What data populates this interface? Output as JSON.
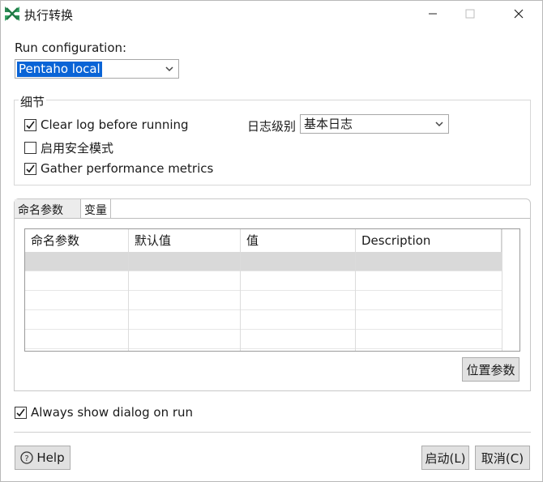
{
  "window": {
    "title": "执行转换",
    "app_icon": "pentaho-spoon-icon"
  },
  "run_configuration": {
    "label": "Run configuration:",
    "selected": "Pentaho local"
  },
  "details": {
    "group_title": "细节",
    "clear_log": {
      "label": "Clear log before running",
      "checked": true
    },
    "safe_mode": {
      "label": "启用安全模式",
      "checked": false
    },
    "gather_metrics": {
      "label": "Gather performance metrics",
      "checked": true
    },
    "log_level_label": "日志级别",
    "log_level_value": "基本日志"
  },
  "tabs": [
    {
      "label": "命名参数",
      "active": true
    },
    {
      "label": "变量",
      "active": false
    }
  ],
  "params_table": {
    "columns": [
      "命名参数",
      "默认值",
      "值",
      "Description"
    ],
    "rows": [
      [
        "",
        "",
        "",
        ""
      ],
      [
        "",
        "",
        "",
        ""
      ],
      [
        "",
        "",
        "",
        ""
      ],
      [
        "",
        "",
        "",
        ""
      ],
      [
        "",
        "",
        "",
        ""
      ]
    ]
  },
  "position_params_button": "位置参数",
  "always_show": {
    "label": "Always show dialog on run",
    "checked": true
  },
  "footer": {
    "help_label": "Help",
    "start_label": "启动(L)",
    "cancel_label": "取消(C)"
  },
  "colors": {
    "selection": "#0a64d6",
    "check": "#1a1a1a",
    "icon_green": "#2e8b57"
  }
}
